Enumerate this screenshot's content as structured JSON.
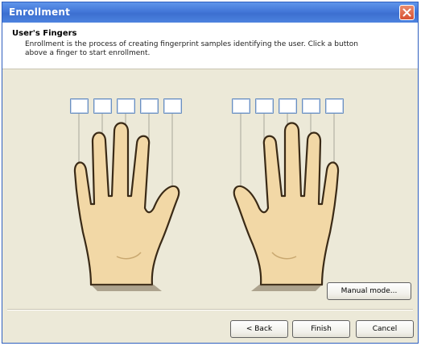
{
  "window": {
    "title": "Enrollment"
  },
  "header": {
    "title": "User's Fingers",
    "description": "Enrollment is the process of creating fingerprint samples identifying the user. Click a button above a finger to start enrollment."
  },
  "buttons": {
    "manual_mode": "Manual mode...",
    "back": "< Back",
    "finish": "Finish",
    "cancel": "Cancel"
  },
  "icons": {
    "close": "close-icon"
  },
  "colors": {
    "titlebar": "#4377d8",
    "dialog_bg": "#ece9d8",
    "skin": "#f2d8a6",
    "finger_button_border": "#6a8fc0"
  }
}
